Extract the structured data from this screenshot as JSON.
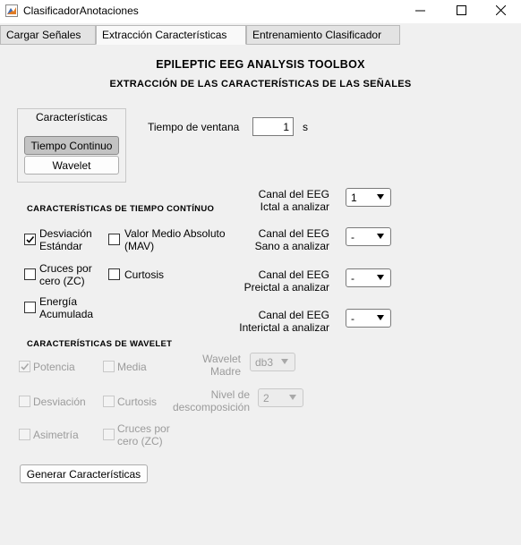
{
  "window": {
    "title": "ClasificadorAnotaciones"
  },
  "tabs": [
    "Cargar Señales",
    "Extracción Características",
    "Entrenamiento Clasificador"
  ],
  "header": {
    "title": "EPILEPTIC EEG ANALYSIS TOOLBOX",
    "subtitle": "EXTRACCIÓN DE LAS CARACTERÍSTICAS DE LAS SEÑALES"
  },
  "features_panel": {
    "title": "Características",
    "buttons": [
      "Tiempo Continuo",
      "Wavelet"
    ],
    "selected": "Tiempo Continuo"
  },
  "window_time": {
    "label": "Tiempo de ventana",
    "value": "1",
    "unit": "s"
  },
  "time_section": {
    "title": "CARACTERÍSTICAS DE TIEMPO CONTÍNUO",
    "checkboxes": [
      {
        "label1": "Desviación",
        "label2": "Estándar",
        "checked": true
      },
      {
        "label1": "Valor Medio Absoluto",
        "label2": "(MAV)",
        "checked": false
      },
      {
        "label1": "Cruces por",
        "label2": "cero (ZC)",
        "checked": false
      },
      {
        "label1": "Curtosis",
        "label2": "",
        "checked": false
      },
      {
        "label1": "Energía",
        "label2": "Acumulada",
        "checked": false
      }
    ]
  },
  "channels": [
    {
      "label1": "Canal del EEG",
      "label2": "Ictal a analizar",
      "value": "1"
    },
    {
      "label1": "Canal del EEG",
      "label2": "Sano a analizar",
      "value": "-"
    },
    {
      "label1": "Canal del EEG",
      "label2": "Preictal a analizar",
      "value": "-"
    },
    {
      "label1": "Canal del EEG",
      "label2": "Interictal a analizar",
      "value": "-"
    }
  ],
  "wavelet_section": {
    "title": "CARACTERÍSTICAS DE WAVELET",
    "checkboxes": [
      {
        "label1": "Potencia",
        "label2": "",
        "checked": true
      },
      {
        "label1": "Media",
        "label2": "",
        "checked": false
      },
      {
        "label1": "Desviación",
        "label2": "",
        "checked": false
      },
      {
        "label1": "Curtosis",
        "label2": "",
        "checked": false
      },
      {
        "label1": "Asimetría",
        "label2": "",
        "checked": false
      },
      {
        "label1": "Cruces por",
        "label2": "cero (ZC)",
        "checked": false
      }
    ],
    "mother": {
      "label1": "Wavelet",
      "label2": "Madre",
      "value": "db3"
    },
    "level": {
      "label1": "Nivel de",
      "label2": "descomposición",
      "value": "2"
    }
  },
  "generate_button": "Generar Características",
  "icons": {
    "app": "matlab-figure-icon",
    "minimize": "minimize-icon",
    "maximize": "maximize-icon",
    "close": "close-icon",
    "check": "checkmark-icon",
    "dropdown": "chevron-down-icon"
  },
  "colors": {
    "selected_button": "#c3c3c3",
    "disabled_text": "#9b9b9b",
    "background": "#f0f0f0"
  }
}
